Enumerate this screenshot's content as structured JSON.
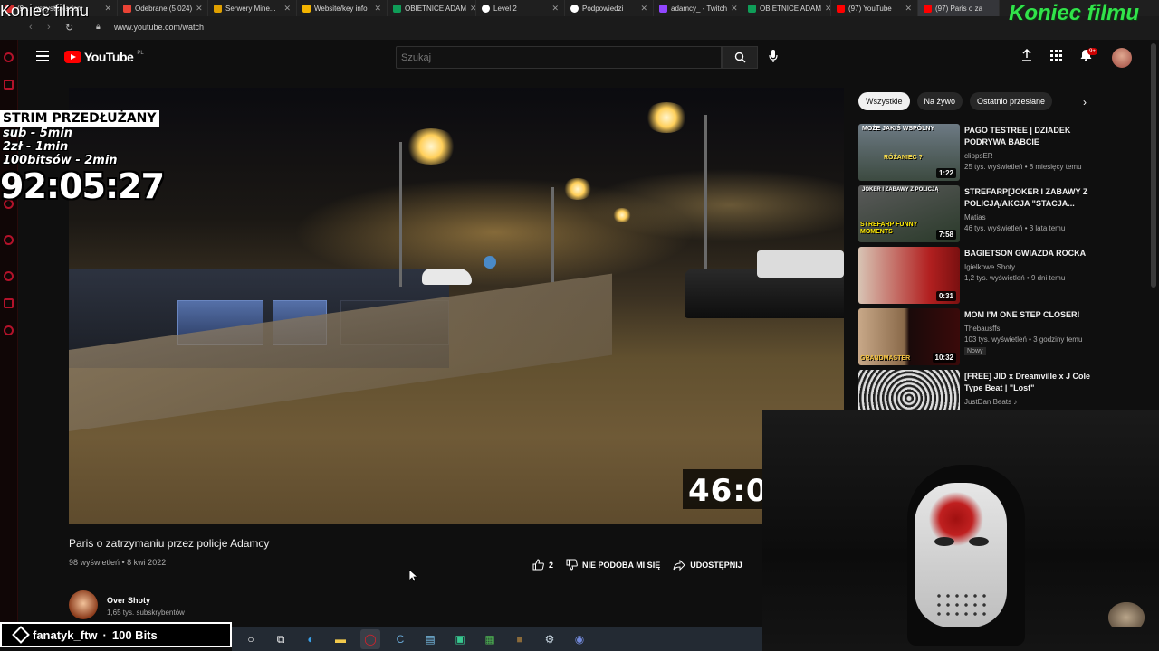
{
  "browser": {
    "tabs": [
      {
        "label": "(9 ... wszystko adam",
        "fav": "#d32f2f"
      },
      {
        "label": "Odebrane (5 024)",
        "fav": "#ea4335"
      },
      {
        "label": "Serwery Mine...",
        "fav": "#e0a000"
      },
      {
        "label": "Website/key info",
        "fav": "#f4b400"
      },
      {
        "label": "OBIETNICE ADAM",
        "fav": "#0f9d58"
      },
      {
        "label": "Level 2",
        "fav": "#ffffff"
      },
      {
        "label": "Podpowiedzi",
        "fav": "#ffffff"
      },
      {
        "label": "adamcy_ - Twitch",
        "fav": "#9146ff"
      },
      {
        "label": "OBIETNICE ADAM",
        "fav": "#0f9d58"
      },
      {
        "label": "(97) YouTube",
        "fav": "#ff0000"
      },
      {
        "label": "(97) Paris o za",
        "fav": "#ff0000"
      }
    ],
    "url": "www.youtube.com/watch"
  },
  "stream_overlay": {
    "koniec_left": "Koniec filmu",
    "koniec_right": "Koniec filmu",
    "title": "STRIM PRZEDŁUŻANY",
    "lines": [
      "sub - 5min",
      "2zł - 1min",
      "100bitsów - 2min"
    ],
    "timer": "92:05:27",
    "bits_alert": {
      "user": "fanatyk_ftw",
      "sep": " · ",
      "amount": "100 Bits"
    }
  },
  "youtube": {
    "logo": "YouTube",
    "logo_country": "PL",
    "search_placeholder": "Szukaj",
    "notifications_badge": "9+",
    "video": {
      "timestamp": "46:0",
      "title": "Paris o zatrzymaniu przez policje Adamcy",
      "views": "98 wyświetleń • 8 kwi 2022",
      "likes": "2",
      "dislike_label": "NIE PODOBA MI SIĘ",
      "share_label": "UDOSTĘPNIJ"
    },
    "channel": {
      "name": "Over Shoty",
      "subs": "1,65 tys. subskrybentów"
    },
    "chips": [
      "Wszystkie",
      "Na żywo",
      "Ostatnio przesłane"
    ],
    "recommendations": [
      {
        "title": "PAGO TESTREE | DZIADEK PODRYWA BABCIE",
        "channel": "clippsER",
        "meta": "25 tys. wyświetleń • 8 miesięcy temu",
        "duration": "1:22",
        "thumb_text": "MOŻE JAKIŚ WSPÓLNY",
        "thumb_text2": "RÓŻANIEC ?"
      },
      {
        "title": "STREFARP[JOKER I ZABAWY Z POLICJĄ/AKCJA \"STACJA...",
        "channel": "Matias",
        "meta": "46 tys. wyświetleń • 3 lata temu",
        "duration": "7:58",
        "thumb_text": "JOKER I ZABAWY Z POLICJĄ",
        "thumb_text2": "STREFARP FUNNY MOMENTS"
      },
      {
        "title": "BAGIETSON GWIAZDA ROCKA",
        "channel": "Igielkowe Shoty",
        "meta": "1,2 tys. wyświetleń • 9 dni temu",
        "duration": "0:31"
      },
      {
        "title": "MOM I'M ONE STEP CLOSER!",
        "channel": "Thebausffs",
        "meta": "103 tys. wyświetleń • 3 godziny temu",
        "badge": "Nowy",
        "duration": "10:32",
        "thumb_text": "GRANDMASTER"
      },
      {
        "title": "[FREE] JID x Dreamville x J Cole Type Beat | \"Lost\"",
        "channel": "JustDan Beats ♪"
      }
    ]
  }
}
